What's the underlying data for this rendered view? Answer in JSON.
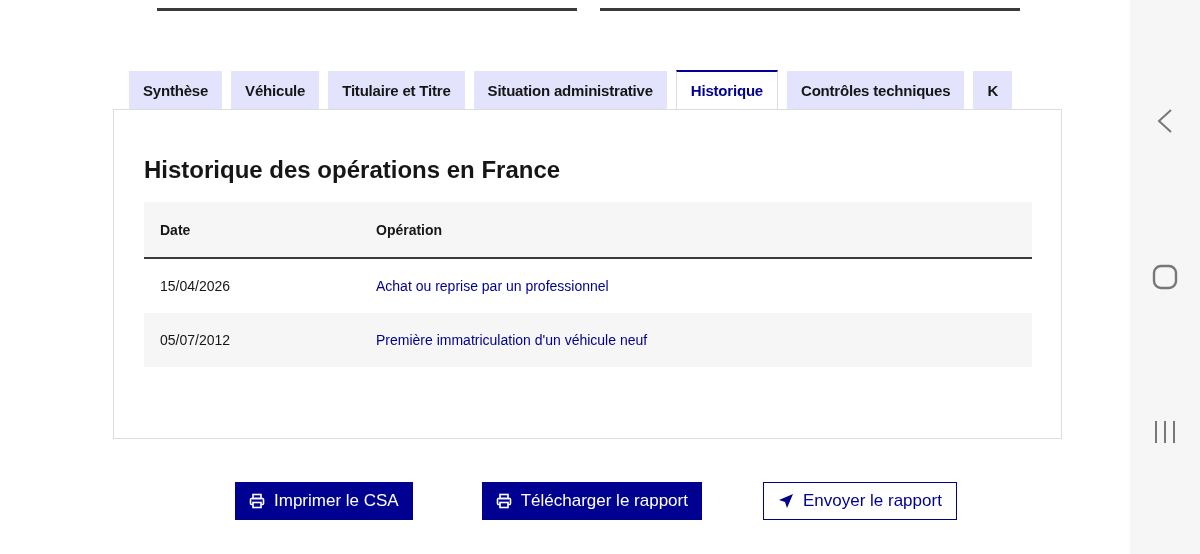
{
  "tabs": [
    {
      "label": "Synthèse",
      "selected": false
    },
    {
      "label": "Véhicule",
      "selected": false
    },
    {
      "label": "Titulaire et Titre",
      "selected": false
    },
    {
      "label": "Situation administrative",
      "selected": false
    },
    {
      "label": "Historique",
      "selected": true
    },
    {
      "label": "Contrôles techniques",
      "selected": false
    },
    {
      "label": "K",
      "selected": false
    }
  ],
  "section_title": "Historique des opérations en France",
  "table": {
    "columns": [
      "Date",
      "Opération"
    ],
    "rows": [
      [
        "15/04/2026",
        "Achat ou reprise par un professionnel"
      ],
      [
        "05/07/2012",
        "Première immatriculation d'un véhicule neuf"
      ]
    ]
  },
  "buttons": [
    {
      "label": "Imprimer le CSA",
      "kind": "primary"
    },
    {
      "label": "Télécharger le rapport",
      "kind": "primary"
    },
    {
      "label": "Envoyer le rapport",
      "kind": "secondary"
    }
  ]
}
